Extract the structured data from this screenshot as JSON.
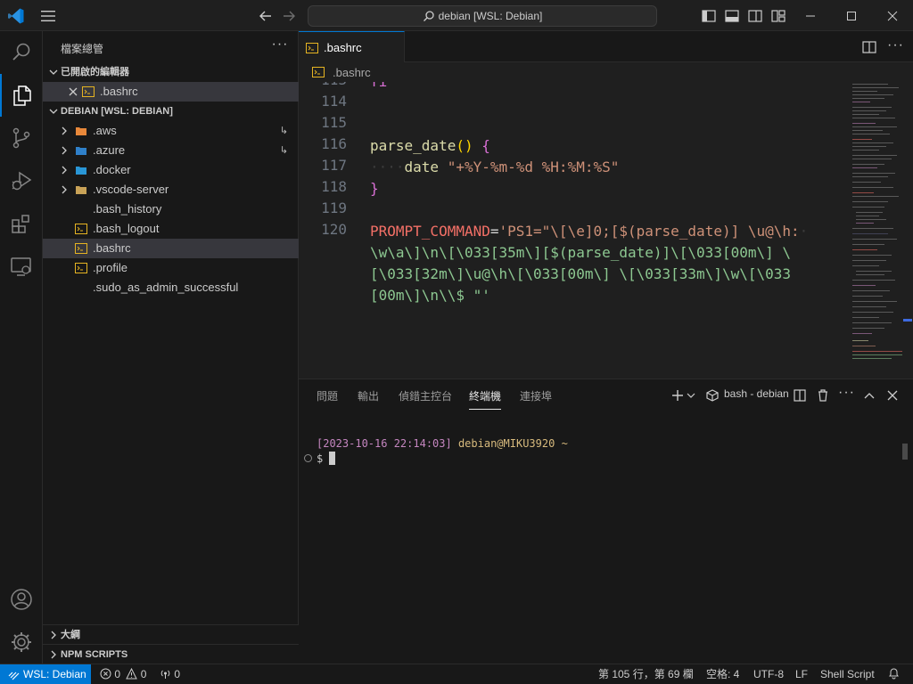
{
  "titlebar": {
    "search_text": "debian [WSL: Debian]"
  },
  "sidebar": {
    "title": "檔案總管",
    "open_editors_header": "已開啟的編輯器",
    "open_editors": [
      ".bashrc"
    ],
    "folder_header": "DEBIAN [WSL: DEBIAN]",
    "items": [
      {
        "label": ".aws",
        "type": "folder"
      },
      {
        "label": ".azure",
        "type": "folder"
      },
      {
        "label": ".docker",
        "type": "folder"
      },
      {
        "label": ".vscode-server",
        "type": "folder"
      },
      {
        "label": ".bash_history",
        "type": "file"
      },
      {
        "label": ".bash_logout",
        "type": "file"
      },
      {
        "label": ".bashrc",
        "type": "file"
      },
      {
        "label": ".profile",
        "type": "file"
      },
      {
        "label": ".sudo_as_admin_successful",
        "type": "file"
      }
    ],
    "outline_header": "大綱",
    "npm_header": "NPM SCRIPTS"
  },
  "editor": {
    "tab_label": ".bashrc",
    "breadcrumb": ".bashrc",
    "line_numbers": [
      "114",
      "115",
      "116",
      "117",
      "118",
      "119",
      "120"
    ],
    "partial_top": "fi",
    "code": {
      "fn_name": "parse_date",
      "fn_parens": "()",
      "brace_open": "{",
      "indent": "····",
      "cmd": "date",
      "cmd_arg": "\"+%Y-%m-%d %H:%M:%S\"",
      "brace_close": "}",
      "var_name": "PROMPT_COMMAND",
      "eq": "=",
      "ps1_line1": "'PS1=\"\\[\\e]0;[$(parse_date)] \\u@\\h:",
      "ps1_line2": "\\w\\a\\]\\n\\[\\033[35m\\][$(parse_date)]\\[\\033[00m\\] \\",
      "ps1_line3": "[\\033[32m\\]\\u@\\h\\[\\033[00m\\] \\[\\033[33m\\]\\w\\[\\033",
      "ps1_line4": "[00m\\]\\n\\\\$ \"'",
      "trail_dot": "·"
    }
  },
  "panel": {
    "tabs": [
      "問題",
      "輸出",
      "偵錯主控台",
      "終端機",
      "連接埠"
    ],
    "active_tab": "終端機",
    "shell_label": "bash - debian",
    "terminal": {
      "timestamp": "[2023-10-16 22:14:03]",
      "userhost": "debian@MIKU3920",
      "cwd": "~",
      "prompt": "$"
    }
  },
  "statusbar": {
    "remote": "WSL: Debian",
    "errors": "0",
    "warnings": "0",
    "ports": "0",
    "position": "第 105 行，第 69 欄",
    "spaces": "空格: 4",
    "encoding": "UTF-8",
    "eol": "LF",
    "language": "Shell Script"
  },
  "colors": {
    "accent": "#0078d4",
    "background": "#1f1f1f",
    "sidebar_bg": "#181818"
  }
}
